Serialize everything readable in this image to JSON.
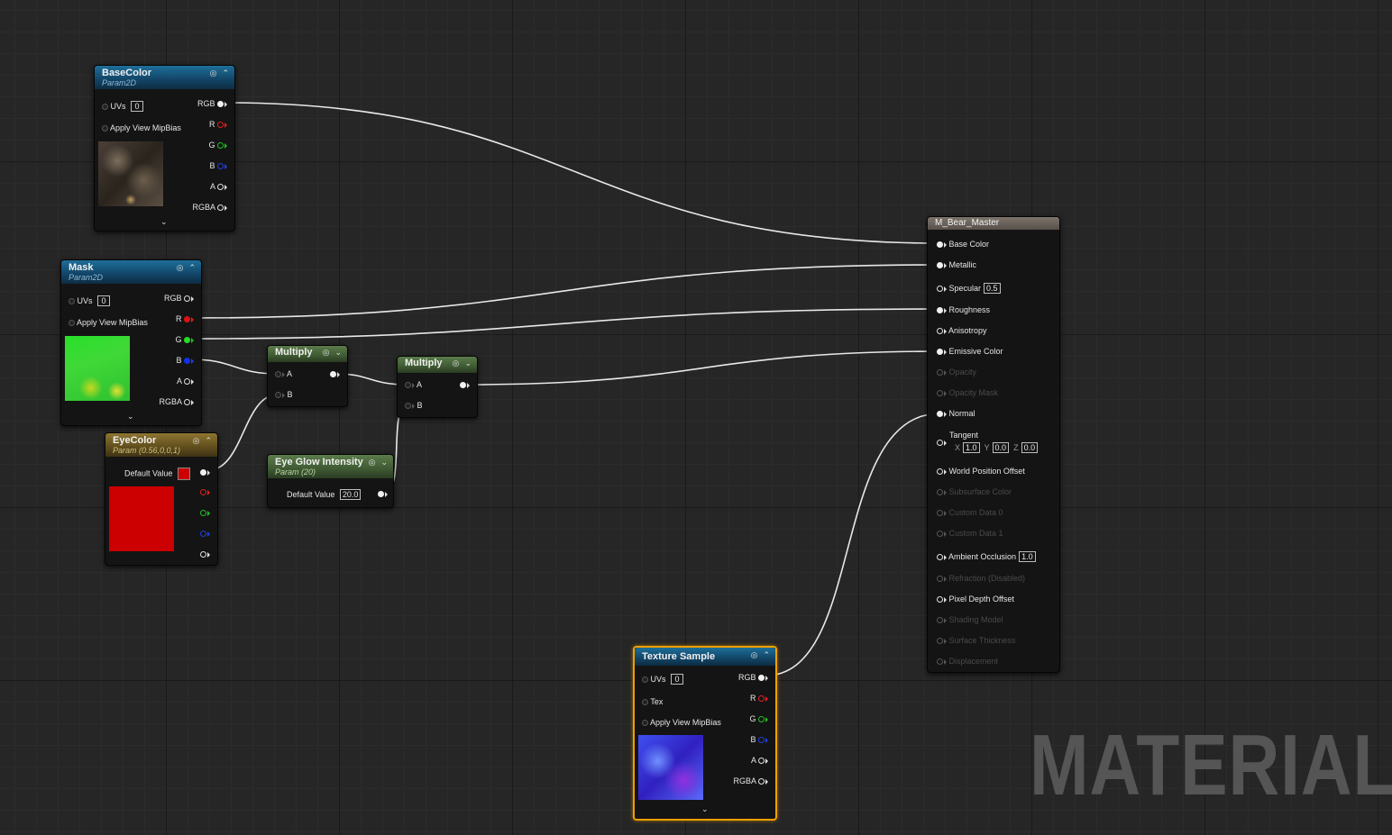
{
  "watermark": "MATERIAL",
  "nodes": {
    "basecolor": {
      "title": "BaseColor",
      "subtitle": "Param2D",
      "uvs_label": "UVs",
      "uvs_value": "0",
      "mip_label": "Apply View MipBias",
      "outputs": [
        "RGB",
        "R",
        "G",
        "B",
        "A",
        "RGBA"
      ]
    },
    "mask": {
      "title": "Mask",
      "subtitle": "Param2D",
      "uvs_label": "UVs",
      "uvs_value": "0",
      "mip_label": "Apply View MipBias",
      "outputs": [
        "RGB",
        "R",
        "G",
        "B",
        "A",
        "RGBA"
      ]
    },
    "eyecolor": {
      "title": "EyeColor",
      "subtitle": "Param (0.56,0,0,1)",
      "default_label": "Default Value",
      "swatch_color": "#cc0000"
    },
    "multiply1": {
      "title": "Multiply",
      "a_label": "A",
      "b_label": "B"
    },
    "multiply2": {
      "title": "Multiply",
      "a_label": "A",
      "b_label": "B"
    },
    "eyeglow": {
      "title": "Eye Glow Intensity",
      "subtitle": "Param (20)",
      "default_label": "Default Value",
      "default_value": "20.0"
    },
    "texture": {
      "title": "Texture Sample",
      "uvs_label": "UVs",
      "uvs_value": "0",
      "tex_label": "Tex",
      "mip_label": "Apply View MipBias",
      "outputs": [
        "RGB",
        "R",
        "G",
        "B",
        "A",
        "RGBA"
      ]
    },
    "master": {
      "title": "M_Bear_Master",
      "inputs": {
        "base_color": "Base Color",
        "metallic": "Metallic",
        "specular": "Specular",
        "specular_value": "0.5",
        "roughness": "Roughness",
        "anisotropy": "Anisotropy",
        "emissive": "Emissive Color",
        "opacity": "Opacity",
        "opacity_mask": "Opacity Mask",
        "normal": "Normal",
        "tangent": "Tangent",
        "tangent_x_label": "X",
        "tangent_x": "1.0",
        "tangent_y_label": "Y",
        "tangent_y": "0.0",
        "tangent_z_label": "Z",
        "tangent_z": "0.0",
        "wpo": "World Position Offset",
        "subsurface": "Subsurface Color",
        "custom0": "Custom Data 0",
        "custom1": "Custom Data 1",
        "ao": "Ambient Occlusion",
        "ao_value": "1.0",
        "refraction": "Refraction (Disabled)",
        "pdo": "Pixel Depth Offset",
        "shading_model": "Shading Model",
        "surface_thickness": "Surface Thickness",
        "displacement": "Displacement"
      }
    }
  },
  "colors": {
    "wire": "#e8e8e8",
    "selection": "#f0a000",
    "param_header": "#124466",
    "vector_param_header": "#5f4d1c",
    "math_header": "#3f5a33"
  }
}
